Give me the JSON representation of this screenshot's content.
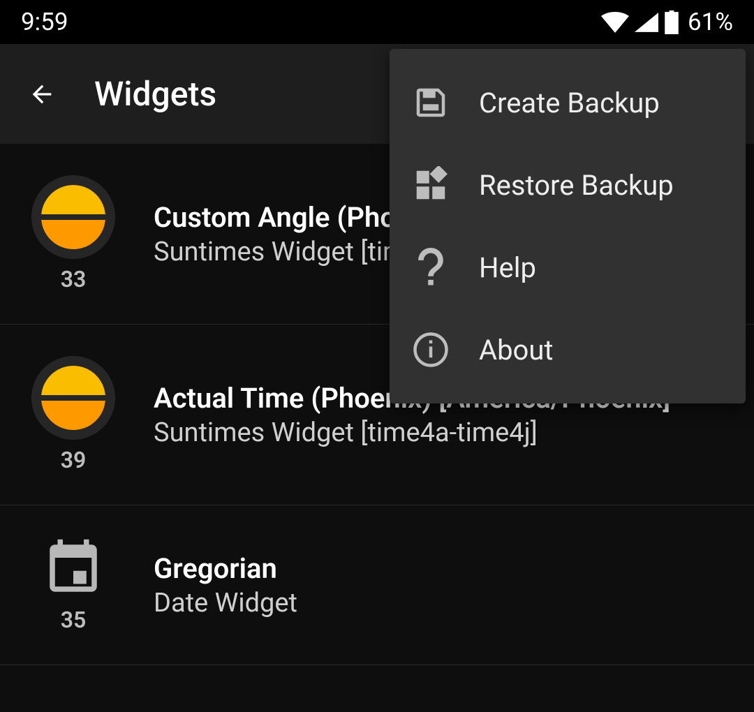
{
  "statusBar": {
    "time": "9:59",
    "battery": "61%"
  },
  "appBar": {
    "title": "Widgets"
  },
  "widgets": [
    {
      "id": "33",
      "title": "Custom Angle (Phoenix) [America/Phoenix]",
      "subtitle": "Suntimes Widget [time4a-time4j]",
      "iconType": "sun"
    },
    {
      "id": "39",
      "title": "Actual Time (Phoenix) [America/Phoenix]",
      "subtitle": "Suntimes Widget [time4a-time4j]",
      "iconType": "sun"
    },
    {
      "id": "35",
      "title": "Gregorian",
      "subtitle": "Date Widget",
      "iconType": "calendar"
    }
  ],
  "menu": {
    "items": [
      {
        "label": "Create Backup"
      },
      {
        "label": "Restore Backup"
      },
      {
        "label": "Help"
      },
      {
        "label": "About"
      }
    ]
  }
}
